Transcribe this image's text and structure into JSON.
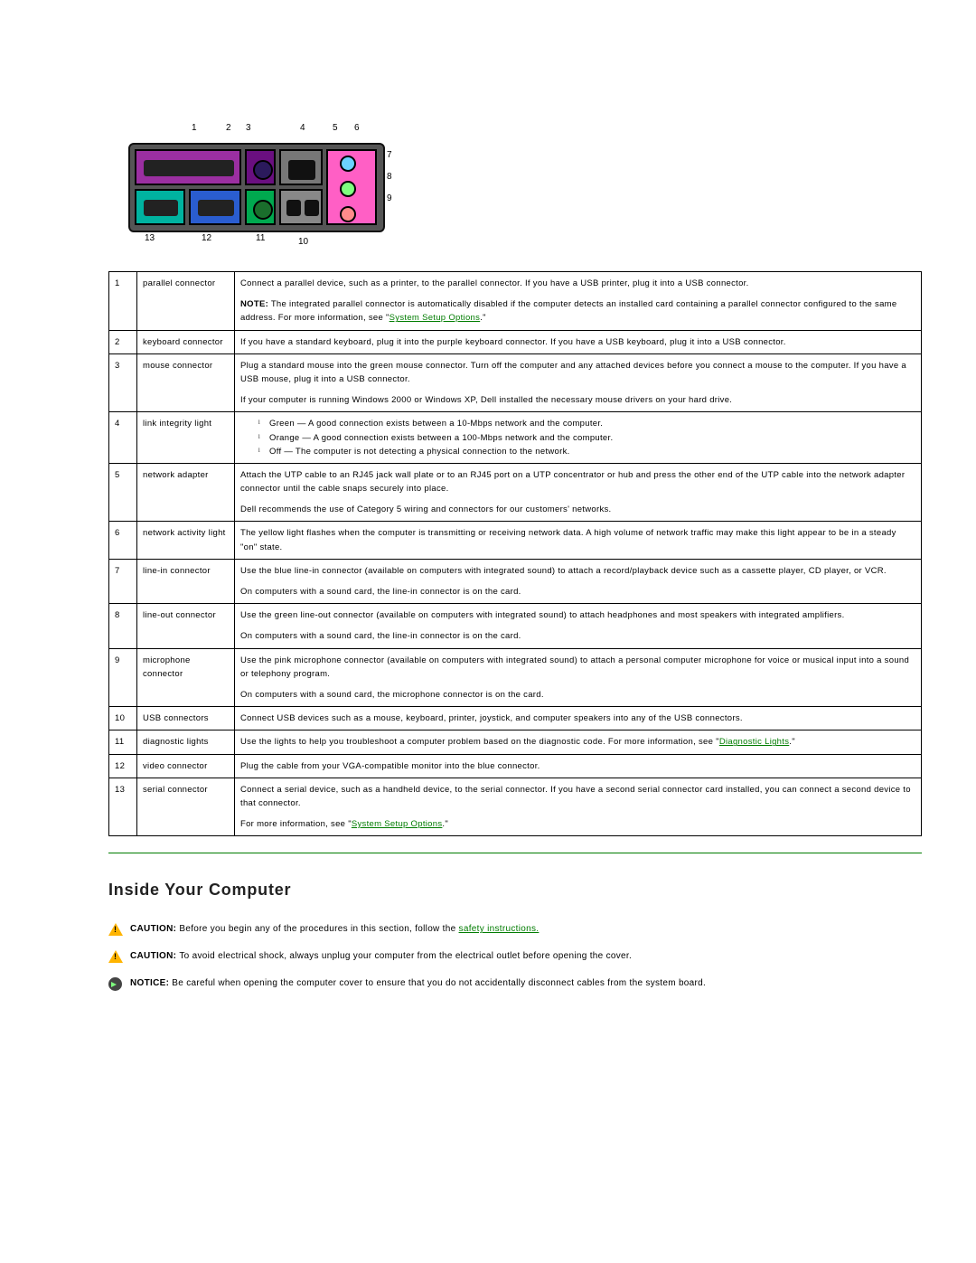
{
  "diagram_labels": {
    "n1": "1",
    "n2": "2",
    "n3": "3",
    "n4": "4",
    "n5": "5",
    "n6": "6",
    "n7": "7",
    "n8": "8",
    "n9": "9",
    "n10": "10",
    "n11": "11",
    "n12": "12",
    "n13": "13"
  },
  "table": {
    "rows": [
      {
        "num": "1",
        "label": "parallel connector",
        "desc": "Connect a parallel device, such as a printer, to the parallel connector. If you have a USB printer, plug it into a USB connector.",
        "note_prefix": "NOTE:",
        "note": " The integrated parallel connector is automatically disabled if the computer detects an installed card containing a parallel connector configured to the same address. For more information, see \"",
        "note_link": "System Setup Options",
        "note_suffix": ".\""
      },
      {
        "num": "2",
        "label": "keyboard connector",
        "desc": "If you have a standard keyboard, plug it into the purple keyboard connector. If you have a USB keyboard, plug it into a USB connector."
      },
      {
        "num": "3",
        "label": "mouse connector",
        "desc": "Plug a standard mouse into the green mouse connector. Turn off the computer and any attached devices before you connect a mouse to the computer. If you have a USB mouse, plug it into a USB connector.",
        "desc2": "If your computer is running Windows 2000 or Windows XP, Dell installed the necessary mouse drivers on your hard drive."
      },
      {
        "num": "4",
        "label": "link integrity light",
        "bullets": [
          "Green — A good connection exists between a 10-Mbps network and the computer.",
          "Orange — A good connection exists between a 100-Mbps network and the computer.",
          "Off — The computer is not detecting a physical connection to the network."
        ]
      },
      {
        "num": "5",
        "label": "network adapter",
        "desc": "Attach the UTP cable to an RJ45 jack wall plate or to an RJ45 port on a UTP concentrator or hub and press the other end of the UTP cable into the network adapter connector until the cable snaps securely into place.",
        "desc2": "Dell recommends the use of Category 5 wiring and connectors for our customers' networks."
      },
      {
        "num": "6",
        "label": "network activity light",
        "desc": "The yellow light flashes when the computer is transmitting or receiving network data. A high volume of network traffic may make this light appear to be in a steady \"on\" state."
      },
      {
        "num": "7",
        "label": "line-in connector",
        "desc": "Use the blue line-in connector (available on computers with integrated sound) to attach a record/playback device such as a cassette player, CD player, or VCR.",
        "desc2": "On computers with a sound card, the line-in connector is on the card."
      },
      {
        "num": "8",
        "label": "line-out connector",
        "desc": "Use the green line-out connector (available on computers with integrated sound) to attach headphones and most speakers with integrated amplifiers.",
        "desc2": "On computers with a sound card, the line-in connector is on the card."
      },
      {
        "num": "9",
        "label": "microphone connector",
        "desc": "Use the pink microphone connector (available on computers with integrated sound) to attach a personal computer microphone for voice or musical input into a sound or telephony program.",
        "desc2": "On computers with a sound card, the microphone connector is on the card."
      },
      {
        "num": "10",
        "label": "USB connectors",
        "desc": "Connect USB devices such as a mouse, keyboard, printer, joystick, and computer speakers into any of the USB connectors."
      },
      {
        "num": "11",
        "label": "diagnostic lights",
        "desc_prefix": "Use the lights to help you troubleshoot a computer problem based on the diagnostic code. For more information, see \"",
        "desc_link": "Diagnostic Lights",
        "desc_suffix": ".\""
      },
      {
        "num": "12",
        "label": "video connector",
        "desc": "Plug the cable from your VGA-compatible monitor into the blue connector."
      },
      {
        "num": "13",
        "label": "serial connector",
        "desc": "Connect a serial device, such as a handheld device, to the serial connector. If you have a second serial connector card installed, you can connect a second device to that connector.",
        "desc2_prefix": "For more information, see \"",
        "desc2_link": "System Setup Options",
        "desc2_suffix": ".\""
      }
    ]
  },
  "section_heading": "Inside Your Computer",
  "alerts": {
    "a1_prefix": "CAUTION: ",
    "a1_text": "Before you begin any of the procedures in this section, follow the ",
    "a1_link": "safety instructions.",
    "a2_prefix": "CAUTION: ",
    "a2_text": "To avoid electrical shock, always unplug your computer from the electrical outlet before opening the cover.",
    "a3_prefix": "NOTICE: ",
    "a3_text": "Be careful when opening the computer cover to ensure that you do not accidentally disconnect cables from the system board."
  }
}
